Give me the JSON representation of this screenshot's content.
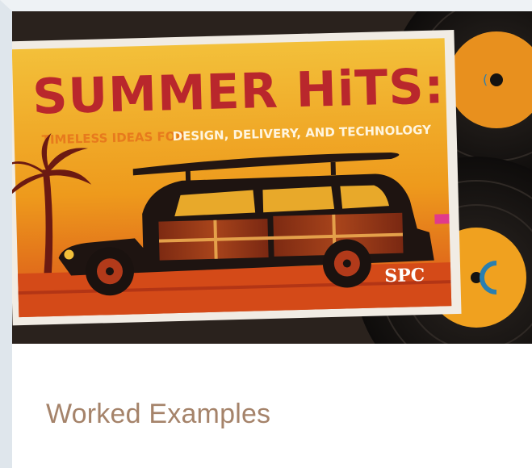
{
  "card": {
    "title": "Worked Examples",
    "image": {
      "headline": "SUMMER HiTS:",
      "subtitle_left": "TIMELESS IDEAS FOR",
      "subtitle_right": "DESIGN, DELIVERY, AND TECHNOLOGY",
      "logo": "SPC"
    }
  },
  "colors": {
    "title_text": "#a5836a",
    "card_border": "#dfe6ec",
    "poster_yellow": "#f0b21c",
    "poster_orange": "#e4661a",
    "headline_red": "#b9272c",
    "record_orange": "#e8901e",
    "record_black": "#151311"
  }
}
